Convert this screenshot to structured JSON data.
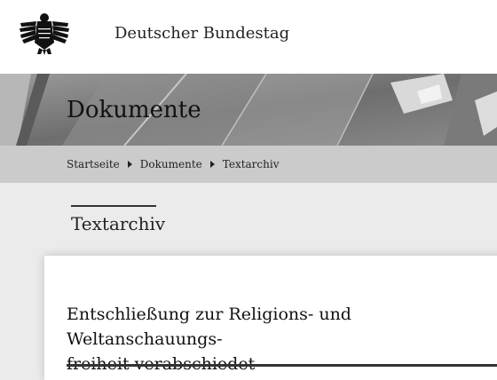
{
  "header": {
    "site_title": "Deutscher Bundestag",
    "logo_icon": "federal-eagle-icon"
  },
  "banner": {
    "title": "Dokumente"
  },
  "breadcrumb": {
    "items": [
      {
        "label": "Startseite"
      },
      {
        "label": "Dokumente"
      },
      {
        "label": "Textarchiv"
      }
    ],
    "separator_icon": "triangle-right-icon"
  },
  "section": {
    "title": "Textarchiv"
  },
  "article": {
    "title_line1": "Entschließung zur Religions- und Weltanschauungs-",
    "title_line2": "freiheit verabschiedet"
  }
}
